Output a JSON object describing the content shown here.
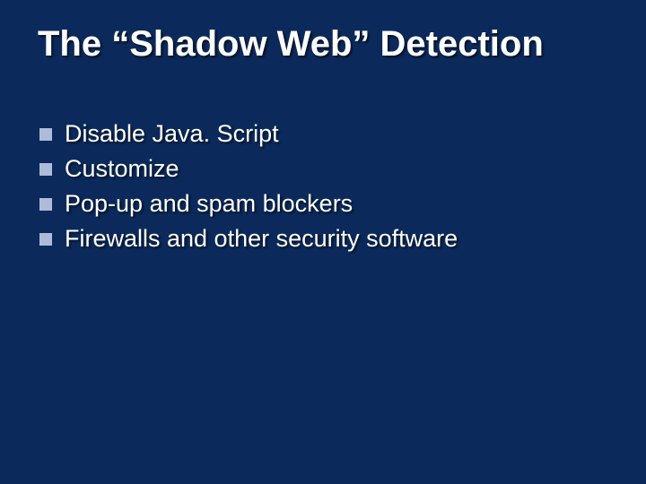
{
  "slide": {
    "title": "The “Shadow Web” Detection",
    "bullets": [
      "Disable Java. Script",
      "Customize",
      "Pop-up and spam blockers",
      "Firewalls and other security software"
    ]
  },
  "colors": {
    "background": "#0b2a5b",
    "text": "#ffffff",
    "bullet": "#aebbd9"
  }
}
